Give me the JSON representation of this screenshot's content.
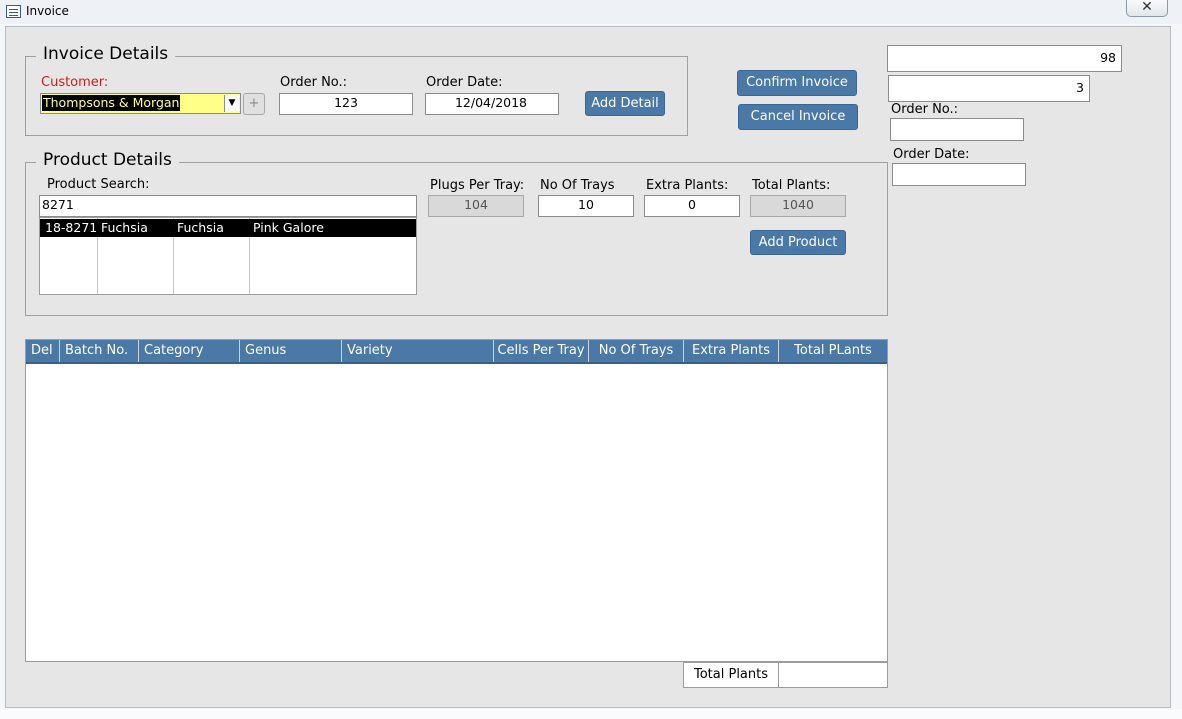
{
  "window": {
    "title": "Invoice",
    "close_glyph": "✕"
  },
  "invoice_details": {
    "legend": "Invoice Details",
    "customer_label": "Customer:",
    "customer_value": "Thompsons & Morgan",
    "customer_label_color": "#d01c1c",
    "new_customer_glyph": "+",
    "order_no_label": "Order No.:",
    "order_no_value": "123",
    "order_date_label": "Order Date:",
    "order_date_value": "12/04/2018",
    "add_detail_label": "Add Detail"
  },
  "actions": {
    "confirm_label": "Confirm Invoice",
    "cancel_label": "Cancel Invoice"
  },
  "side_panel": {
    "field_top_value": "98",
    "field_second_value": "3",
    "order_no_label": "Order No.:",
    "order_no_value": "",
    "order_date_label": "Order Date:",
    "order_date_value": ""
  },
  "product_details": {
    "legend": "Product Details",
    "search_label": "Product Search:",
    "search_value": "8271",
    "search_results": [
      {
        "batch": "18-8271",
        "category": "Fuchsia",
        "genus": "Fuchsia",
        "variety": "Pink Galore"
      }
    ],
    "plugs_per_tray_label": "Plugs Per Tray:",
    "plugs_per_tray_value": "104",
    "no_of_trays_label": "No Of Trays",
    "no_of_trays_value": "10",
    "extra_plants_label": "Extra Plants:",
    "extra_plants_value": "0",
    "total_plants_label": "Total Plants:",
    "total_plants_value": "1040",
    "add_product_label": "Add Product"
  },
  "details_grid": {
    "columns": [
      "Del",
      "Batch No.",
      "Category",
      "Genus",
      "Variety",
      "Cells Per Tray",
      "No Of Trays",
      "Extra Plants",
      "Total PLants"
    ],
    "rows": []
  },
  "footer": {
    "total_label": "Total Plants",
    "total_value": ""
  },
  "colors": {
    "accent_button": "#4a78a7",
    "form_background": "#e6e6e6",
    "combo_highlight": "#ffff88"
  }
}
